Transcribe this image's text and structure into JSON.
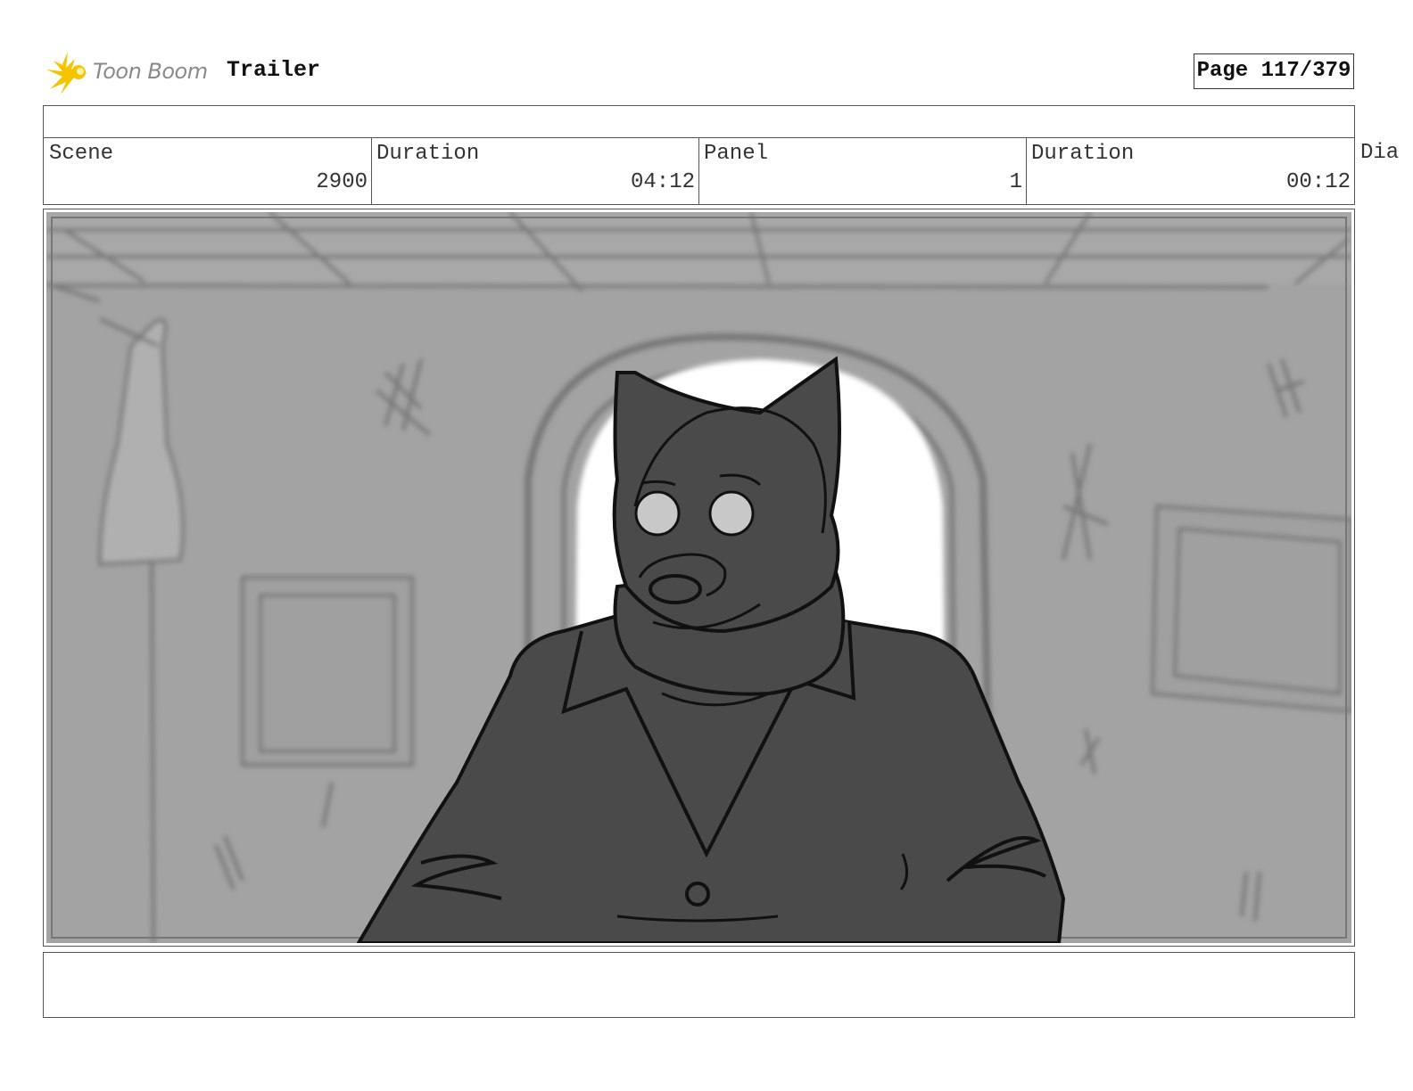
{
  "header": {
    "brand": "Toon Boom",
    "project_title": "Trailer",
    "page_label": "Page 117/379"
  },
  "info": {
    "scene_label": "Scene",
    "scene_value": "2900",
    "scene_duration_label": "Duration",
    "scene_duration_value": "04:12",
    "panel_label": "Panel",
    "panel_value": "1",
    "panel_duration_label": "Duration",
    "panel_duration_value": "00:12",
    "dialogue_label_partial": "Dia"
  },
  "colors": {
    "logo_yellow": "#f5c400",
    "sketch_bg": "#a3a3a3",
    "character_fill": "#4a4a4a"
  },
  "icons": [
    "toon-boom-starburst-icon"
  ]
}
